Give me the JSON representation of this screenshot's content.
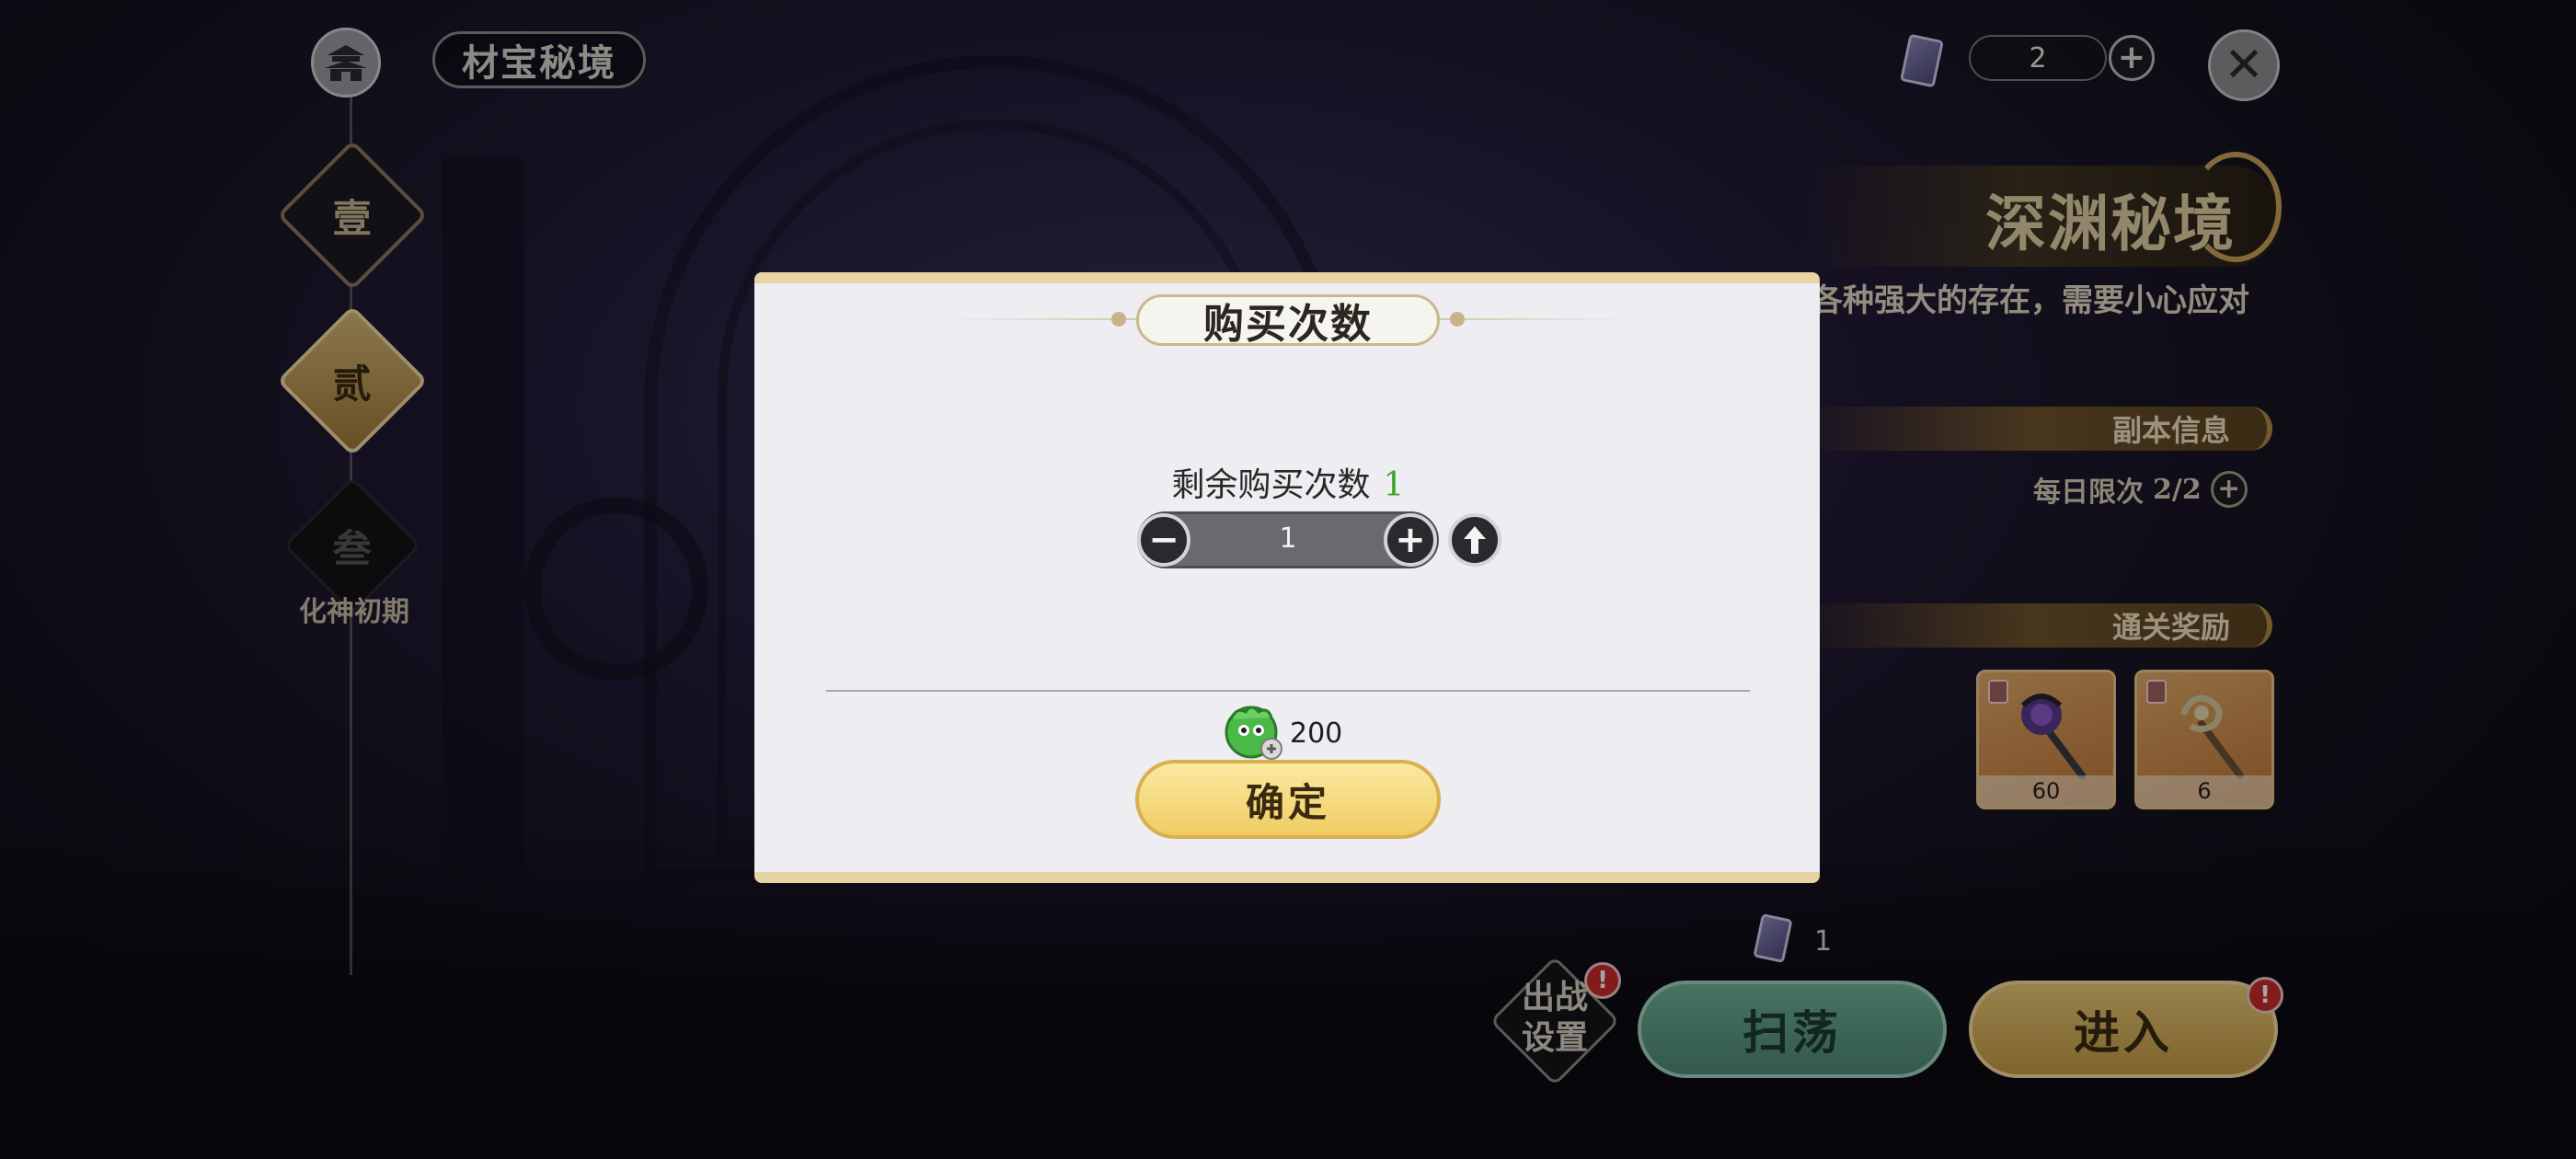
{
  "header": {
    "title": "材宝秘境",
    "ticket_count": "2"
  },
  "stages": [
    {
      "label": "壹",
      "state": "unlocked"
    },
    {
      "label": "贰",
      "state": "selected"
    },
    {
      "label": "叁",
      "state": "locked",
      "requirement": "化神初期"
    }
  ],
  "dungeon": {
    "title": "深渊秘境",
    "description": "各种强大的存在，需要小心应对",
    "info_label": "副本信息",
    "daily_limit_label": "每日限次",
    "daily_limit_value": "2/2",
    "reward_label": "通关奖励",
    "rewards": [
      {
        "name": "purple-staff",
        "count": "60"
      },
      {
        "name": "golden-staff",
        "count": "6"
      }
    ],
    "entry_cost": "1"
  },
  "actions": {
    "battle_setup": "出战\n设置",
    "sweep": "扫荡",
    "enter": "进入",
    "badge": "!"
  },
  "modal": {
    "title": "购买次数",
    "remaining_label": "剩余购买次数",
    "remaining_value": "1",
    "quantity": "1",
    "price": "200",
    "confirm": "确定"
  },
  "colors": {
    "accent_gold": "#e6d4a4",
    "remaining_green": "#3aa42a",
    "sweep_green": "#4e8a76",
    "enter_gold": "#c49a44"
  }
}
